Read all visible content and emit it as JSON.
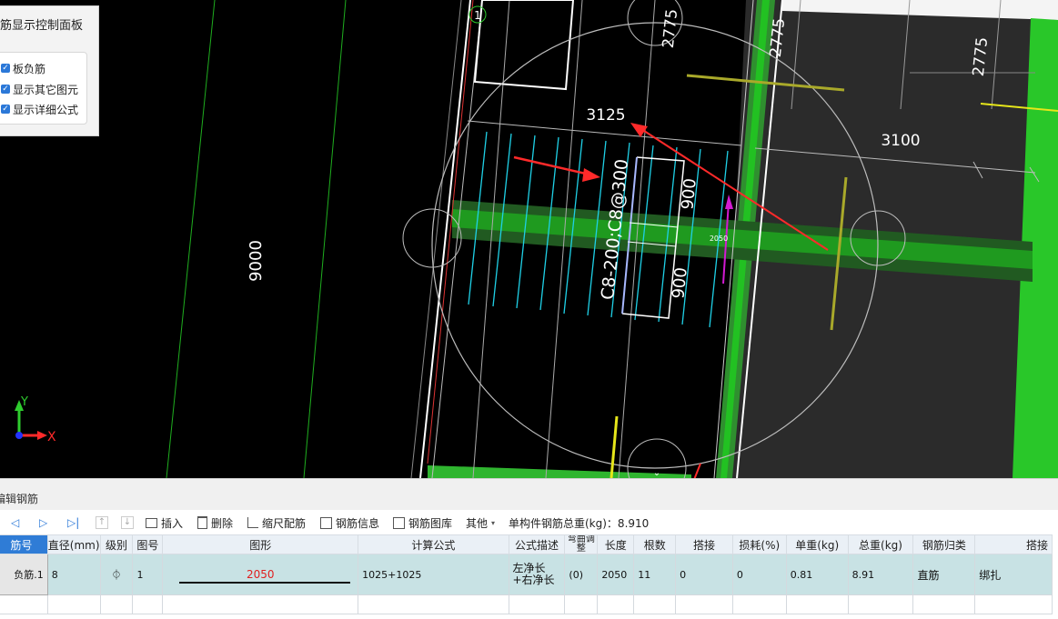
{
  "panel": {
    "title": "筋显示控制面板",
    "options": [
      {
        "label": "板负筋",
        "checked": true
      },
      {
        "label": "显示其它图元",
        "checked": true
      },
      {
        "label": "显示详细公式",
        "checked": true
      }
    ]
  },
  "cad": {
    "dims": {
      "d9000": "9000",
      "d2775a": "2775",
      "d2775b": "2775",
      "d2775c": "2775",
      "d3125": "3125",
      "d3100": "3100",
      "d900a": "900",
      "d900b": "900",
      "d2050": "2050"
    },
    "rebar_label": "C8-200;C8@300",
    "axis_marker": "1",
    "axis": {
      "x": "X",
      "y": "Y"
    },
    "colors": {
      "green": "#2ecc2e",
      "cyan": "#1fd0e6",
      "white": "#ffffff",
      "red": "#ff2a2a",
      "yellow": "#e6e61a",
      "magenta": "#d21ad2"
    }
  },
  "editor": {
    "title": "编辑钢筋",
    "toolbar": {
      "insert": "插入",
      "delete": "删除",
      "scale": "缩尺配筋",
      "info": "钢筋信息",
      "library": "钢筋图库",
      "other": "其他",
      "total": "单构件钢筋总重(kg)：8.910"
    },
    "columns": [
      "筋号",
      "直径(mm)",
      "级别",
      "图号",
      "图形",
      "计算公式",
      "公式描述",
      "弯曲调整",
      "长度",
      "根数",
      "搭接",
      "损耗(%)",
      "单重(kg)",
      "总重(kg)",
      "钢筋归类",
      "搭接"
    ],
    "row": {
      "name": "负筋.1",
      "diameter": "8",
      "grade": "⏀",
      "figure_no": "1",
      "shape_value": "2050",
      "formula": "1025+1025",
      "description": "左净长+右净长",
      "bend": "(0)",
      "length": "2050",
      "count": "11",
      "lap": "0",
      "loss": "0",
      "unit_weight": "0.81",
      "total_weight": "8.91",
      "category": "直筋",
      "lap_type": "绑扎"
    }
  }
}
